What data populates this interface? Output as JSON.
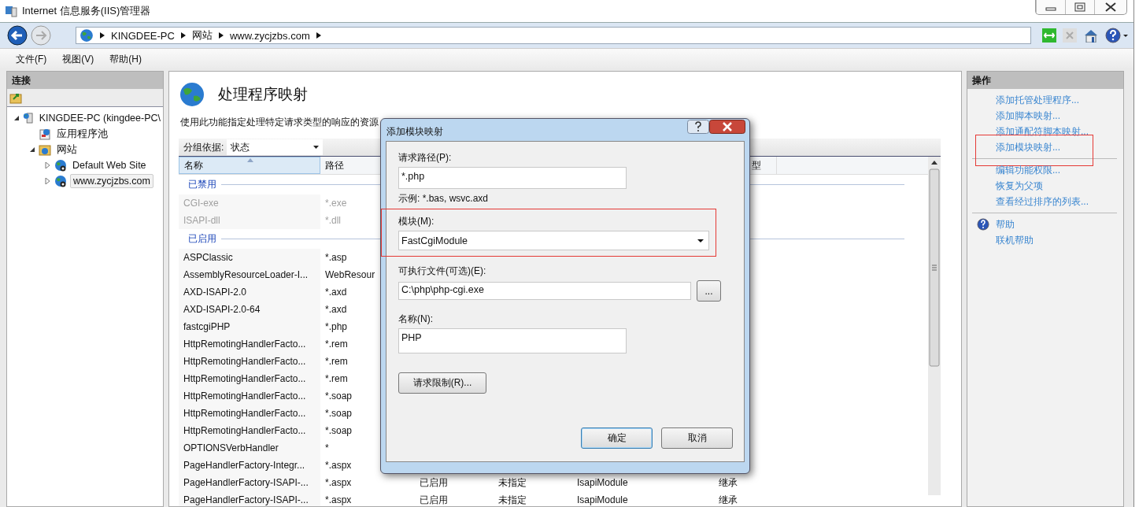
{
  "window": {
    "title": "Internet 信息服务(IIS)管理器"
  },
  "address": {
    "crumbs": [
      "KINGDEE-PC",
      "网站",
      "www.zycjzbs.com"
    ]
  },
  "menu": [
    "文件(F)",
    "视图(V)",
    "帮助(H)"
  ],
  "connections": {
    "title": "连接",
    "tree": [
      {
        "label": "KINGDEE-PC (kingdee-PC\\",
        "kind": "server",
        "expanded": true,
        "selected": false,
        "children": [
          {
            "label": "应用程序池",
            "kind": "pool",
            "selected": false
          },
          {
            "label": "网站",
            "kind": "sites",
            "expanded": true,
            "selected": false,
            "children": [
              {
                "label": "Default Web Site",
                "kind": "site",
                "expanded": false,
                "selected": false
              },
              {
                "label": "www.zycjzbs.com",
                "kind": "site",
                "expanded": false,
                "selected": true
              }
            ]
          }
        ]
      }
    ]
  },
  "feature": {
    "title": "处理程序映射",
    "description": "使用此功能指定处理特定请求类型的响应的资源",
    "group_by": {
      "label": "分组依据:",
      "value": "状态"
    },
    "table": {
      "columns": [
        "名称",
        "路径",
        "",
        "",
        "",
        "型"
      ],
      "rows": [
        {
          "kind": "group",
          "label": "已禁用"
        },
        {
          "kind": "row",
          "disabled": true,
          "cells": [
            "CGI-exe",
            "*.exe"
          ]
        },
        {
          "kind": "row",
          "disabled": true,
          "cells": [
            "ISAPI-dll",
            "*.dll"
          ]
        },
        {
          "kind": "group",
          "label": "已启用"
        },
        {
          "kind": "row",
          "disabled": false,
          "cells": [
            "ASPClassic",
            "*.asp"
          ]
        },
        {
          "kind": "row",
          "disabled": false,
          "cells": [
            "AssemblyResourceLoader-I...",
            "WebResour"
          ]
        },
        {
          "kind": "row",
          "disabled": false,
          "cells": [
            "AXD-ISAPI-2.0",
            "*.axd"
          ]
        },
        {
          "kind": "row",
          "disabled": false,
          "cells": [
            "AXD-ISAPI-2.0-64",
            "*.axd"
          ]
        },
        {
          "kind": "row",
          "disabled": false,
          "cells": [
            "fastcgiPHP",
            "*.php"
          ]
        },
        {
          "kind": "row",
          "disabled": false,
          "cells": [
            "HttpRemotingHandlerFacto...",
            "*.rem"
          ]
        },
        {
          "kind": "row",
          "disabled": false,
          "cells": [
            "HttpRemotingHandlerFacto...",
            "*.rem"
          ]
        },
        {
          "kind": "row",
          "disabled": false,
          "cells": [
            "HttpRemotingHandlerFacto...",
            "*.rem"
          ]
        },
        {
          "kind": "row",
          "disabled": false,
          "cells": [
            "HttpRemotingHandlerFacto...",
            "*.soap"
          ]
        },
        {
          "kind": "row",
          "disabled": false,
          "cells": [
            "HttpRemotingHandlerFacto...",
            "*.soap"
          ]
        },
        {
          "kind": "row",
          "disabled": false,
          "cells": [
            "HttpRemotingHandlerFacto...",
            "*.soap"
          ]
        },
        {
          "kind": "row",
          "disabled": false,
          "cells": [
            "OPTIONSVerbHandler",
            "*"
          ]
        },
        {
          "kind": "row",
          "disabled": false,
          "cells": [
            "PageHandlerFactory-Integr...",
            "*.aspx"
          ]
        },
        {
          "kind": "row",
          "disabled": false,
          "cells": [
            "PageHandlerFactory-ISAPI-...",
            "*.aspx",
            "已启用",
            "未指定",
            "IsapiModule",
            "继承"
          ]
        },
        {
          "kind": "row",
          "disabled": false,
          "cells": [
            "PageHandlerFactory-ISAPI-...",
            "*.aspx",
            "已启用",
            "未指定",
            "IsapiModule",
            "继承"
          ]
        }
      ]
    }
  },
  "actions": {
    "title": "操作",
    "groups": [
      [
        {
          "label": "添加托管处理程序...",
          "highlighted": false
        },
        {
          "label": "添加脚本映射...",
          "highlighted": false
        },
        {
          "label": "添加通配符脚本映射...",
          "highlighted": false
        },
        {
          "label": "添加模块映射...",
          "highlighted": true
        }
      ],
      [
        {
          "label": "编辑功能权限...",
          "highlighted": false
        },
        {
          "label": "恢复为父项",
          "highlighted": false
        },
        {
          "label": "查看经过排序的列表...",
          "highlighted": false
        }
      ],
      [
        {
          "label": "帮助",
          "highlighted": false,
          "kind": "help"
        },
        {
          "label": "联机帮助",
          "highlighted": false
        }
      ]
    ]
  },
  "dialog": {
    "title": "添加模块映射",
    "request_path": {
      "label": "请求路径(P):",
      "value": "*.php",
      "hint": "示例: *.bas, wsvc.axd"
    },
    "module": {
      "label": "模块(M):",
      "value": "FastCgiModule",
      "highlighted": true
    },
    "executable": {
      "label": "可执行文件(可选)(E):",
      "value": "C:\\php\\php-cgi.exe",
      "browse": "..."
    },
    "name": {
      "label": "名称(N):",
      "value": "PHP"
    },
    "restrictions": "请求限制(R)...",
    "buttons": [
      {
        "label": "确定",
        "default": true
      },
      {
        "label": "取消",
        "default": false
      }
    ]
  }
}
